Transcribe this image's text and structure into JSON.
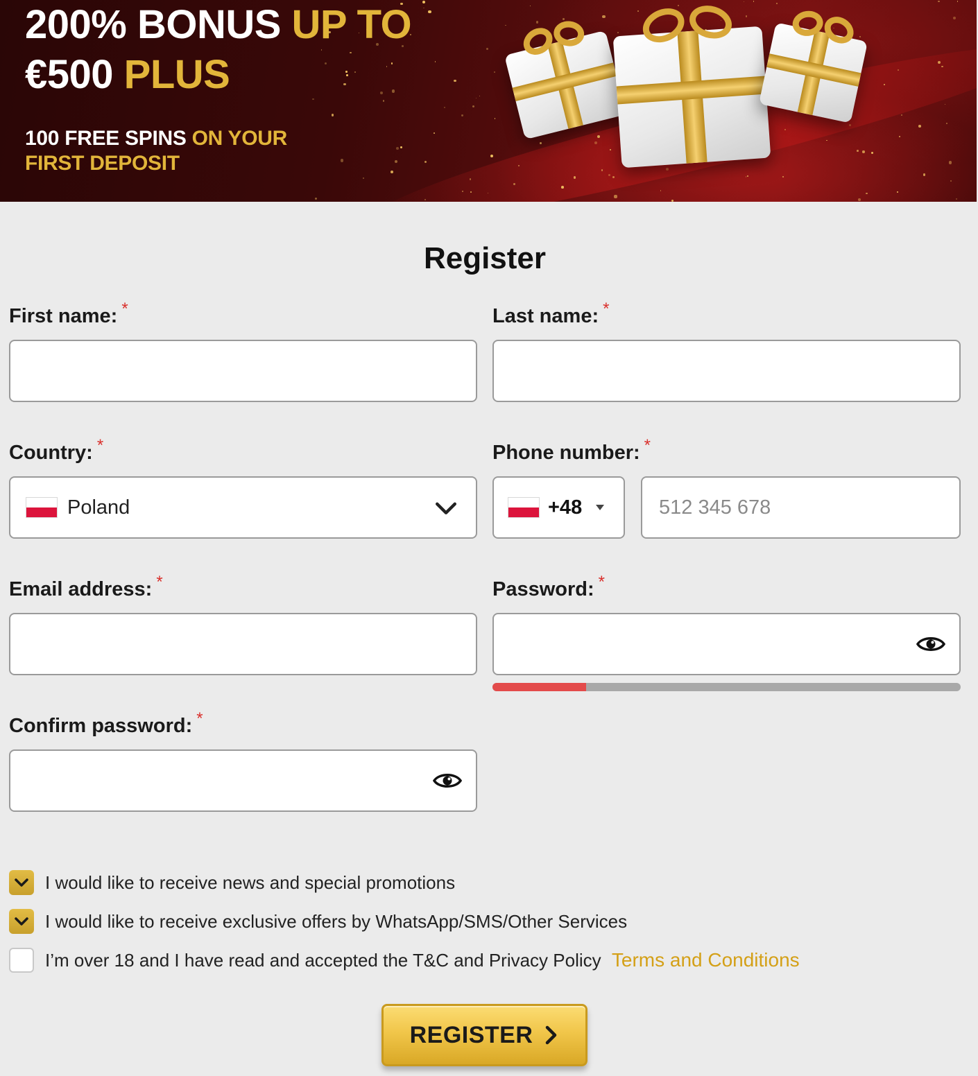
{
  "banner": {
    "headline_white_1": "200% BONUS ",
    "headline_gold_1": "UP TO",
    "headline_white_2": "€500 ",
    "headline_gold_2": "PLUS",
    "sub_white": "100 FREE SPINS ",
    "sub_gold_1": "ON YOUR",
    "sub_gold_2": "FIRST DEPOSIT"
  },
  "form": {
    "title": "Register",
    "required_mark": "*",
    "first_name": {
      "label": "First name:",
      "value": ""
    },
    "last_name": {
      "label": "Last name:",
      "value": ""
    },
    "country": {
      "label": "Country:",
      "selected": "Poland",
      "flag": "poland-flag"
    },
    "phone": {
      "label": "Phone number:",
      "code": "+48",
      "placeholder": "512 345 678",
      "value": ""
    },
    "email": {
      "label": "Email address:",
      "value": ""
    },
    "password": {
      "label": "Password:",
      "value": "",
      "strength": 0.2
    },
    "confirm_password": {
      "label": "Confirm password:",
      "value": ""
    }
  },
  "checkboxes": [
    {
      "label": "I would like to receive news and special promotions",
      "checked": true
    },
    {
      "label": "I would like to receive exclusive offers by WhatsApp/SMS/Other Services",
      "checked": true
    },
    {
      "label": "I’m over 18 and I have read and accepted the T&C and Privacy Policy",
      "checked": false,
      "link": "Terms and Conditions"
    }
  ],
  "register_button": {
    "label": "REGISTER"
  },
  "colors": {
    "gold": "#e2b53a",
    "required": "#d9302c",
    "strength_weak": "#e34b4b",
    "button": "#f1c64a"
  }
}
